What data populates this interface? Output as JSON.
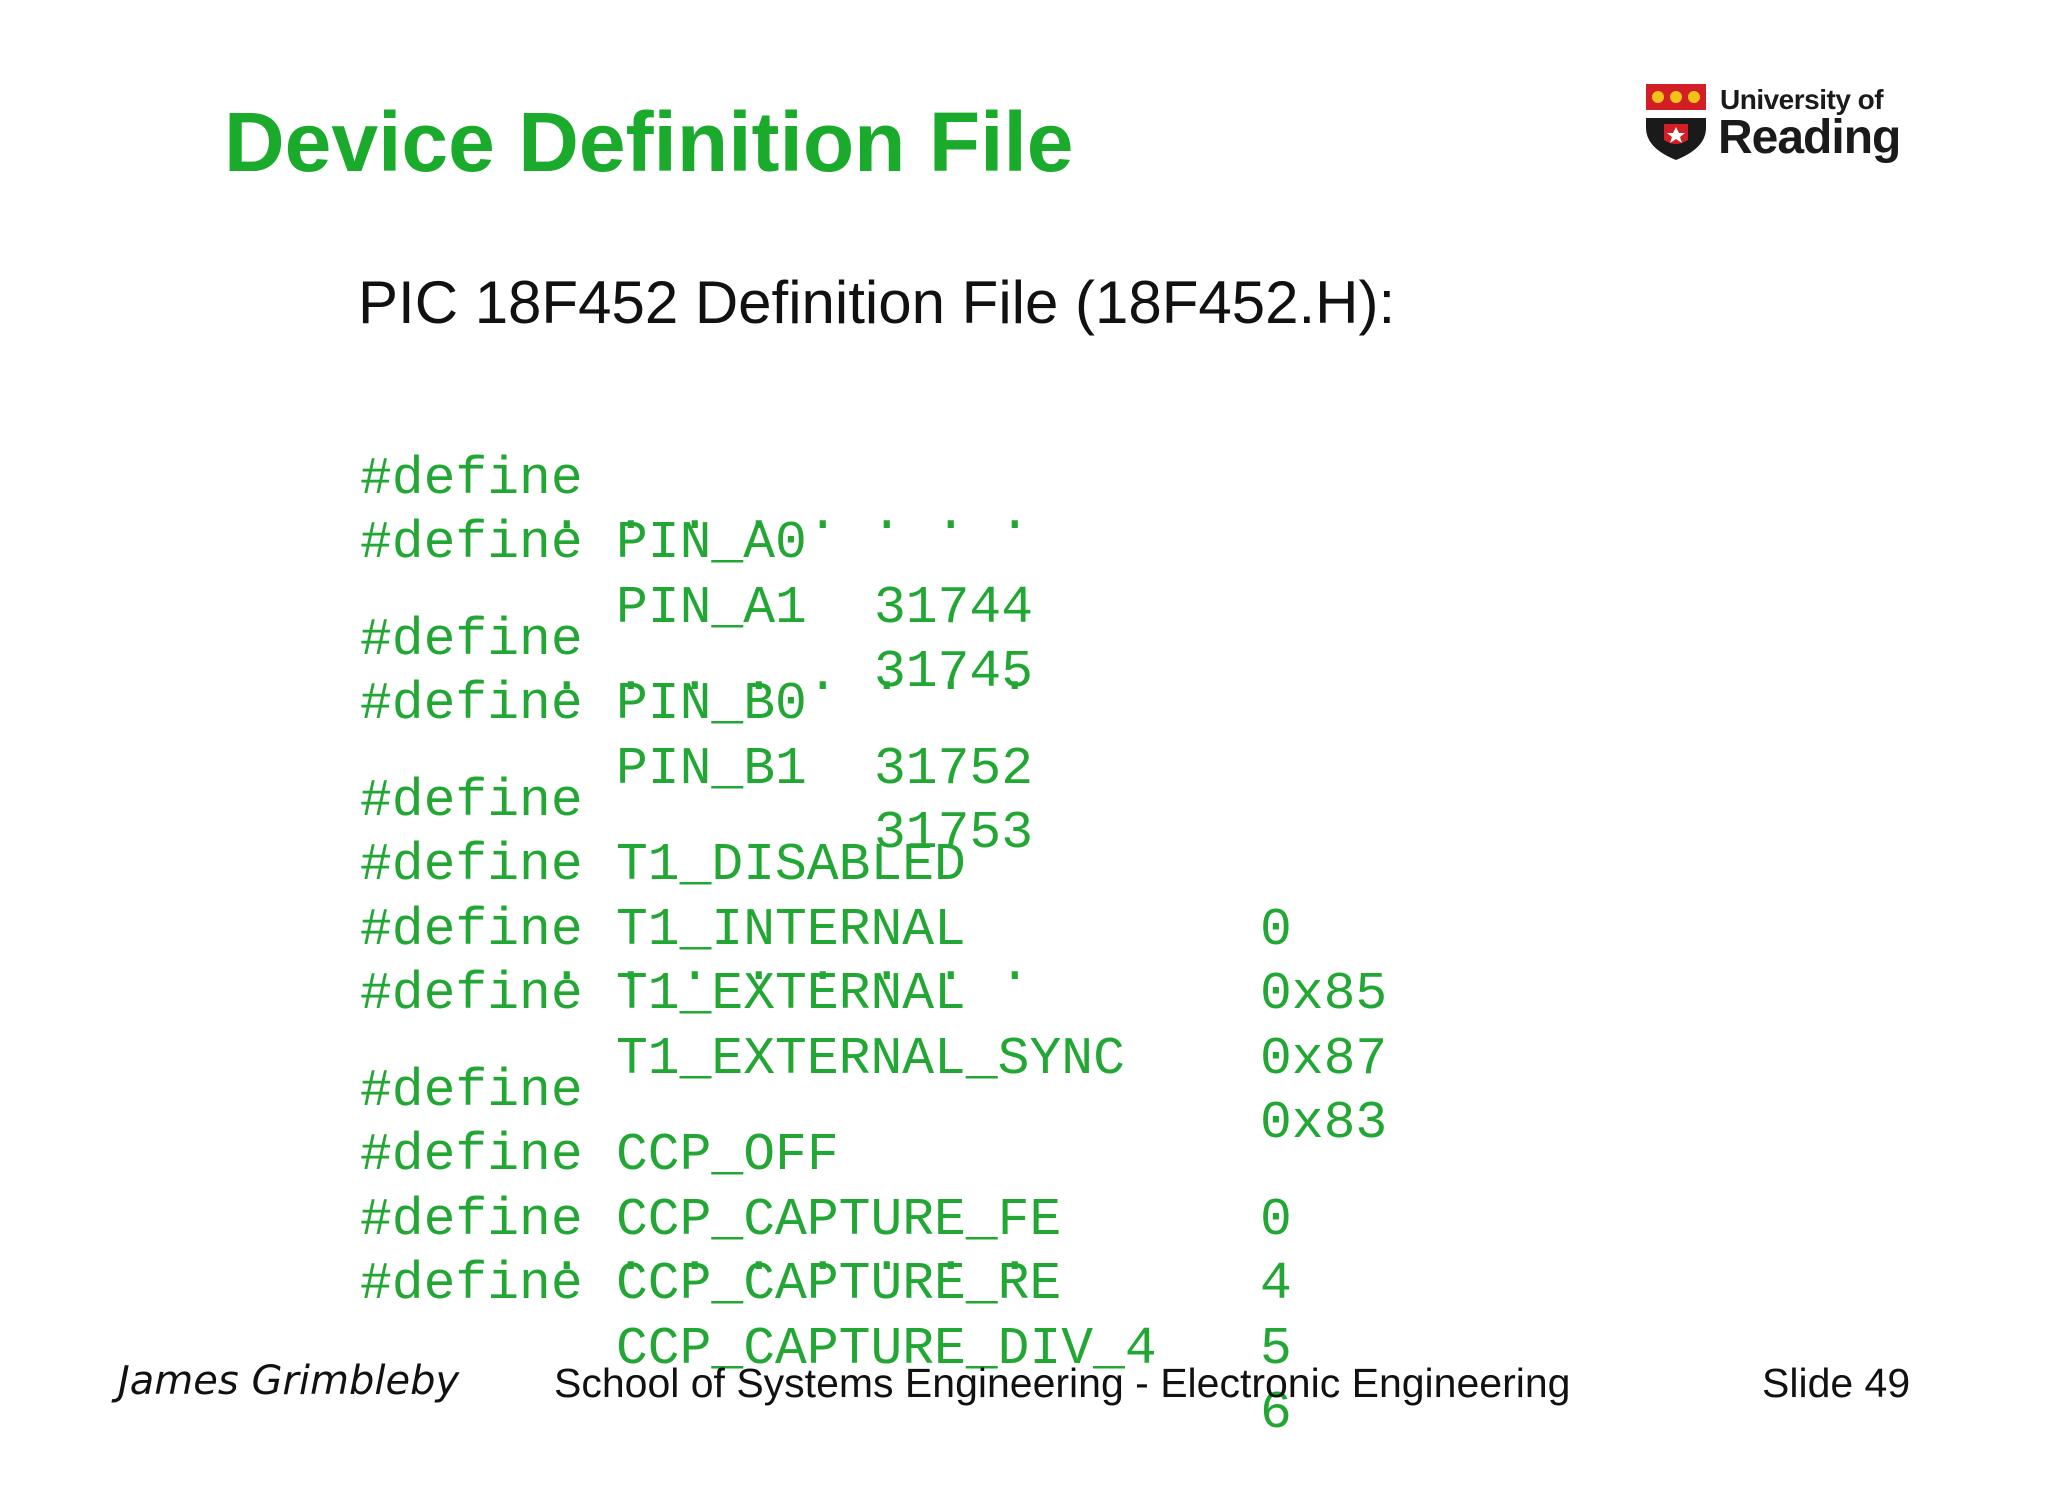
{
  "slide": {
    "title": "Device Definition File",
    "subtitle": "PIC 18F452 Definition File (18F452.H):",
    "logo": {
      "line1": "University of",
      "line2": "Reading",
      "icon": "university-shield-icon",
      "colors": {
        "red": "#d21f26",
        "gold": "#f2c21b",
        "black": "#1a1a1a"
      }
    },
    "accent_color": "#1aab2c",
    "code_color": "#22a634",
    "code": {
      "block1": [
        {
          "kw": "#define",
          "name": "PIN_A0",
          "value": "31744"
        },
        {
          "kw": "#define",
          "name": "PIN_A1",
          "value": "31745"
        }
      ],
      "block2": [
        {
          "kw": "#define",
          "name": "PIN_B0",
          "value": "31752"
        },
        {
          "kw": "#define",
          "name": "PIN_B1",
          "value": "31753"
        }
      ],
      "block3": [
        {
          "kw": "#define",
          "name": "T1_DISABLED",
          "value": "0"
        },
        {
          "kw": "#define",
          "name": "T1_INTERNAL",
          "value": "0x85"
        },
        {
          "kw": "#define",
          "name": "T1_EXTERNAL",
          "value": "0x87"
        },
        {
          "kw": "#define",
          "name": "T1_EXTERNAL_SYNC",
          "value": "0x83"
        }
      ],
      "block4": [
        {
          "kw": "#define",
          "name": "CCP_OFF",
          "value": "0"
        },
        {
          "kw": "#define",
          "name": "CCP_CAPTURE_FE",
          "value": "4"
        },
        {
          "kw": "#define",
          "name": "CCP_CAPTURE_RE",
          "value": "5"
        },
        {
          "kw": "#define",
          "name": "CCP_CAPTURE_DIV_4",
          "value": "6"
        }
      ],
      "ellipsis": [
        "·",
        "·",
        "·",
        "·",
        "·",
        "·",
        "·",
        "·"
      ]
    },
    "footer": {
      "author": "James Grimbleby",
      "school": "School of Systems Engineering - Electronic Engineering",
      "slide_number": "Slide 49"
    }
  }
}
